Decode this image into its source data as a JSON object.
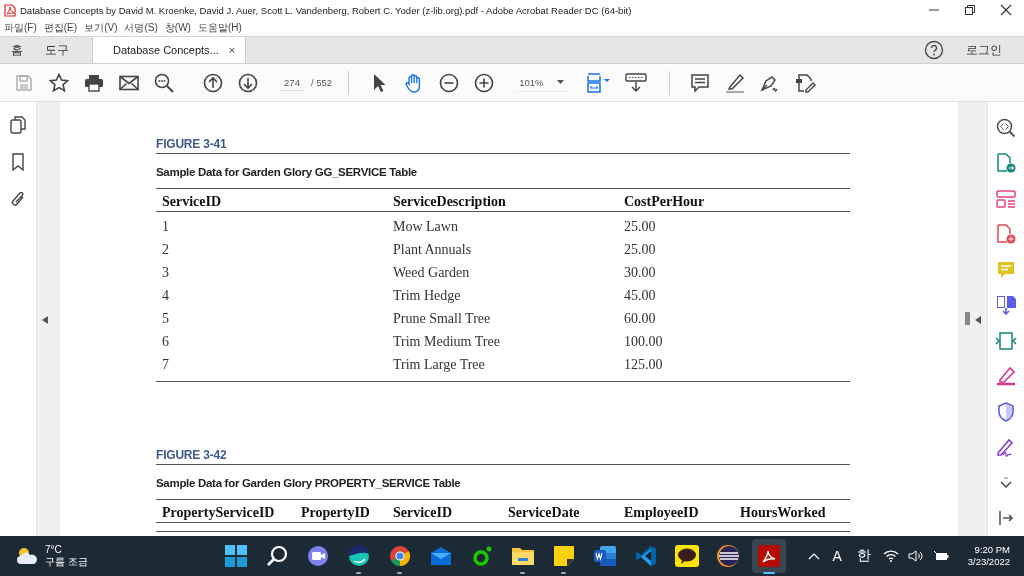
{
  "window": {
    "title": "Database Concepts by David M. Kroenke, David J. Auer, Scott L. Vandenberg, Robert C. Yoder (z-lib.org).pdf - Adobe Acrobat Reader DC (64-bit)"
  },
  "menu": [
    "파일(F)",
    "편집(E)",
    "보기(V)",
    "서명(S)",
    "창(W)",
    "도움말(H)"
  ],
  "tabs": [
    {
      "label": "홈",
      "kind": "nav",
      "selected": false
    },
    {
      "label": "도구",
      "kind": "nav",
      "selected": false
    },
    {
      "label": "Database Concepts...",
      "kind": "document",
      "selected": true,
      "close": "×"
    }
  ],
  "login": "로그인",
  "toolbar": {
    "page": "274",
    "page_total": "/ 552",
    "zoom": "101%"
  },
  "document": {
    "figures": [
      {
        "label": "FIGURE 3-41",
        "caption": "Sample Data for Garden Glory GG_SERVICE Table",
        "columns": [
          "ServiceID",
          "ServiceDescription",
          "CostPerHour"
        ],
        "rows": [
          [
            "1",
            "Mow Lawn",
            "25.00"
          ],
          [
            "2",
            "Plant Annuals",
            "25.00"
          ],
          [
            "3",
            "Weed Garden",
            "30.00"
          ],
          [
            "4",
            "Trim Hedge",
            "45.00"
          ],
          [
            "5",
            "Prune Small Tree",
            "60.00"
          ],
          [
            "6",
            "Trim Medium Tree",
            "100.00"
          ],
          [
            "7",
            "Trim Large Tree",
            "125.00"
          ]
        ]
      },
      {
        "label": "FIGURE 3-42",
        "caption": "Sample Data for Garden Glory PROPERTY_SERVICE Table",
        "columns": [
          "PropertyServiceID",
          "PropertyID",
          "ServiceID",
          "ServiceDate",
          "EmployeeID",
          "HoursWorked"
        ]
      }
    ]
  },
  "taskbar": {
    "weather": {
      "temperature": "7°C",
      "condition": "구름 조금"
    },
    "apps": [
      {
        "kind": "start",
        "running": false,
        "active": false
      },
      {
        "kind": "search",
        "running": false,
        "active": false
      },
      {
        "kind": "chat",
        "running": false,
        "active": false
      },
      {
        "kind": "whale",
        "running": true,
        "active": false
      },
      {
        "kind": "browser",
        "running": true,
        "active": false
      },
      {
        "kind": "mail",
        "running": false,
        "active": false
      },
      {
        "kind": "ring",
        "running": false,
        "active": false
      },
      {
        "kind": "folder",
        "running": true,
        "active": false
      },
      {
        "kind": "note",
        "running": true,
        "active": false
      },
      {
        "kind": "word",
        "running": false,
        "active": false
      },
      {
        "kind": "code",
        "running": false,
        "active": false
      },
      {
        "kind": "talk",
        "running": false,
        "active": false
      },
      {
        "kind": "eclipse",
        "running": false,
        "active": false
      },
      {
        "kind": "pdf",
        "running": true,
        "active": true
      }
    ],
    "input_mode": "A",
    "language": "한",
    "time": "9:20 PM",
    "date": "3/23/2022"
  }
}
